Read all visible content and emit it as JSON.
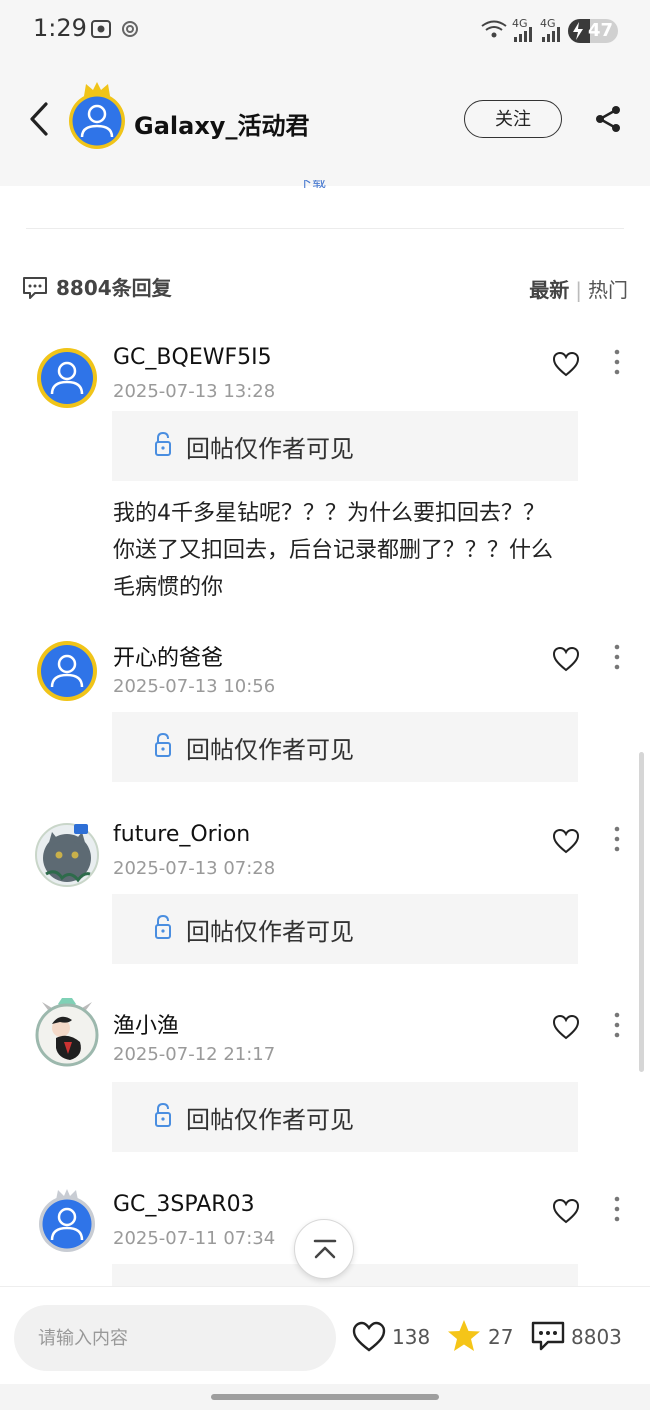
{
  "status_bar": {
    "time": "1:29",
    "battery": "47",
    "network_1": "4G",
    "network_2": "4G"
  },
  "header": {
    "name": "Galaxy_活动君",
    "follow_label": "关注",
    "peek_text": "下载"
  },
  "replies": {
    "count_label": "8804条回复",
    "sort_latest": "最新",
    "sort_hot": "热门"
  },
  "comments": [
    {
      "name": "GC_BQEWF5I5",
      "time": "2025-07-13 13:28",
      "hidden_label": "回帖仅作者可见",
      "body": "我的4千多星钻呢？？？为什么要扣回去？？你送了又扣回去，后台记录都删了？？？什么毛病惯的你"
    },
    {
      "name": "开心的爸爸",
      "time": "2025-07-13 10:56",
      "hidden_label": "回帖仅作者可见"
    },
    {
      "name": "future_Orion",
      "time": "2025-07-13 07:28",
      "hidden_label": "回帖仅作者可见"
    },
    {
      "name": "渔小渔",
      "time": "2025-07-12 21:17",
      "hidden_label": "回帖仅作者可见"
    },
    {
      "name": "GC_3SPAR03",
      "time": "2025-07-11 07:34"
    }
  ],
  "bottom_bar": {
    "input_placeholder": "请输入内容",
    "likes": "138",
    "stars": "27",
    "comments": "8803"
  },
  "colors": {
    "accent_blue": "#2f74e8",
    "gold": "#f0c419",
    "star": "#f5c518"
  }
}
